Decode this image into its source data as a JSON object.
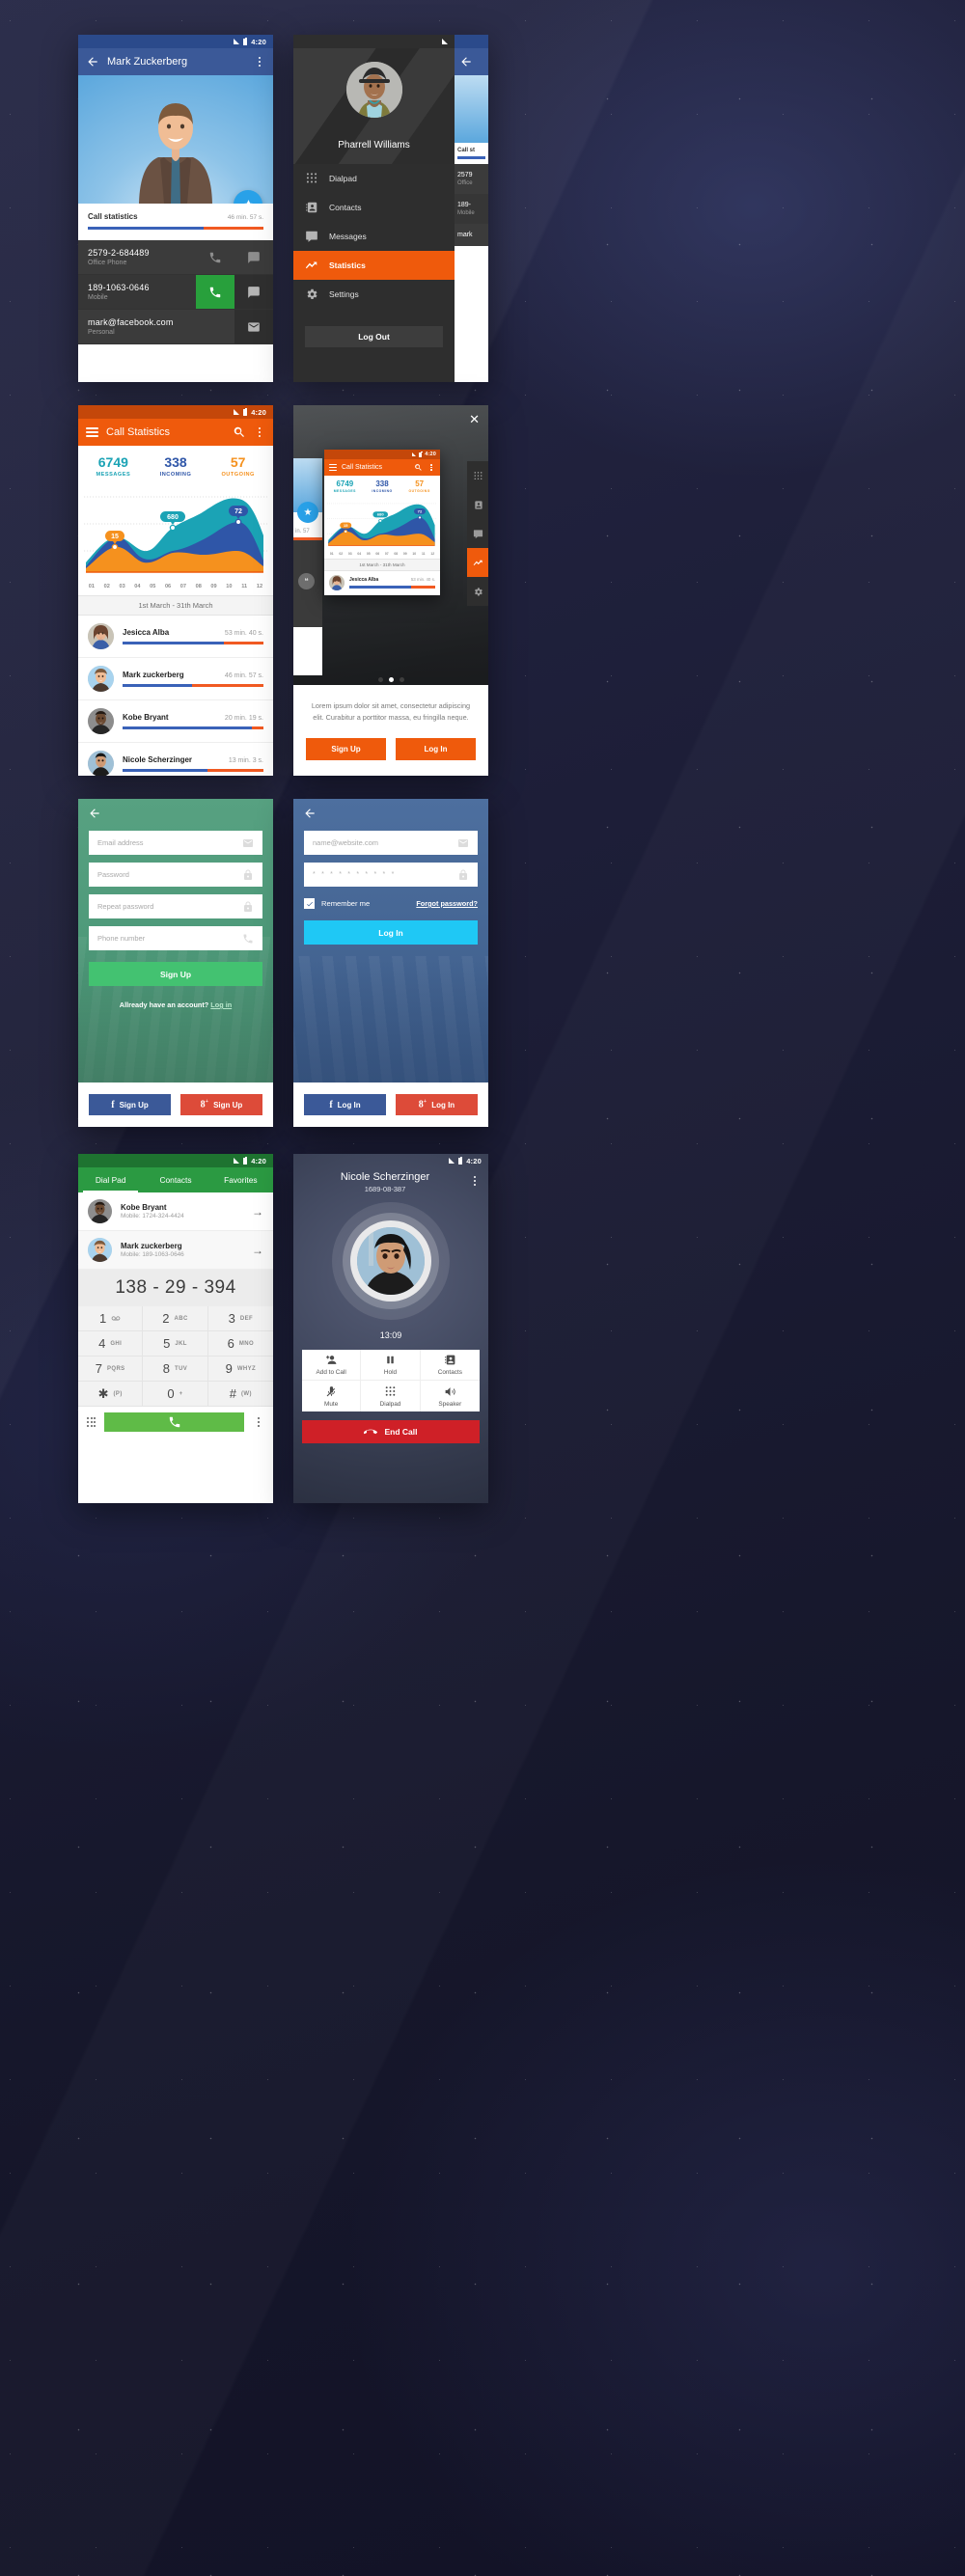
{
  "statusbar": {
    "time": "4:20",
    "signal_icon": "signal-icon",
    "battery_icon": "battery-icon"
  },
  "screen_contact": {
    "title": "Mark Zuckerberg",
    "back_icon": "back-arrow-icon",
    "overflow_icon": "overflow-menu-icon",
    "favorite_icon": "star-icon",
    "stats_label": "Call statistics",
    "stats_value": "46 min. 57 s.",
    "rows": [
      {
        "value": "2579-2-684489",
        "label": "Office Phone",
        "call_icon": "phone-icon",
        "message_icon": "message-icon"
      },
      {
        "value": "189-1063-0646",
        "label": "Mobile",
        "call_icon": "phone-icon",
        "message_icon": "message-icon"
      },
      {
        "value": "mark@facebook.com",
        "label": "Personal",
        "call_icon": "mail-icon",
        "message_icon": "mail-icon"
      }
    ]
  },
  "screen_drawer": {
    "user_name": "Pharrell Williams",
    "avatar_name": "drawer-avatar",
    "items": [
      {
        "label": "Dialpad",
        "icon": "dialpad-icon"
      },
      {
        "label": "Contacts",
        "icon": "contacts-icon"
      },
      {
        "label": "Messages",
        "icon": "messages-icon"
      },
      {
        "label": "Statistics",
        "icon": "statistics-icon"
      },
      {
        "label": "Settings",
        "icon": "settings-icon"
      }
    ],
    "active_index": 3,
    "logout_label": "Log Out",
    "peek_stats_label": "Call st",
    "peek_row1": "2579",
    "peek_row1_sub": "Office",
    "peek_row2": "189-",
    "peek_row2_sub": "Mobile",
    "peek_row3": "mark",
    "accent": "#ef5a0c"
  },
  "screen_statistics": {
    "title": "Call Statistics",
    "menu_icon": "hamburger-icon",
    "search_icon": "search-icon",
    "overflow_icon": "overflow-menu-icon",
    "kpis": [
      {
        "number": "6749",
        "label": "MESSAGES",
        "color": "#1ba3b5"
      },
      {
        "number": "338",
        "label": "INCOMING",
        "color": "#2f56a8"
      },
      {
        "number": "57",
        "label": "OUTGOING",
        "color": "#f5911e"
      }
    ],
    "date_range": "1st March - 31th March",
    "contacts": [
      {
        "name": "Jesicca Alba",
        "duration": "53 min. 40 s.",
        "blue_pct": 72,
        "avatar": "avatar-jessica-alba"
      },
      {
        "name": "Mark zuckerberg",
        "duration": "46 min. 57 s.",
        "blue_pct": 49,
        "avatar": "avatar-mark-zuckerberg"
      },
      {
        "name": "Kobe Bryant",
        "duration": "20 min. 19 s.",
        "blue_pct": 92,
        "avatar": "avatar-kobe-bryant"
      },
      {
        "name": "Nicole Scherzinger",
        "duration": "13 min. 3 s.",
        "blue_pct": 60,
        "avatar": "avatar-nicole-scherzinger"
      }
    ]
  },
  "chart_data": {
    "type": "area",
    "title": "Call Statistics",
    "categories": [
      "01",
      "02",
      "03",
      "04",
      "05",
      "06",
      "07",
      "08",
      "09",
      "10",
      "11",
      "12"
    ],
    "xlabel": "",
    "ylabel": "",
    "ylim": [
      0,
      100
    ],
    "grid": true,
    "legend": "none",
    "series": [
      {
        "name": "MESSAGES",
        "color": "#1ba3b5",
        "values": [
          14,
          26,
          34,
          30,
          22,
          33,
          52,
          60,
          70,
          78,
          74,
          58
        ]
      },
      {
        "name": "INCOMING",
        "color": "#2f56a8",
        "values": [
          10,
          28,
          36,
          24,
          16,
          20,
          26,
          30,
          38,
          52,
          62,
          20
        ]
      },
      {
        "name": "OUTGOING",
        "color": "#f5911e",
        "values": [
          6,
          20,
          28,
          22,
          15,
          22,
          24,
          22,
          20,
          24,
          26,
          12
        ]
      }
    ],
    "annotations": [
      {
        "label": "15",
        "series": "OUTGOING",
        "x": "03",
        "color": "#f5911e"
      },
      {
        "label": "680",
        "series": "MESSAGES",
        "x": "07",
        "color": "#1ba3b5"
      },
      {
        "label": "72",
        "series": "INCOMING",
        "x": "11",
        "color": "#2f56a8"
      }
    ]
  },
  "screen_onboarding": {
    "close_icon": "close-icon",
    "body_text": "Lorem ipsum dolor sit amet, consectetur adipiscing elit. Curabitur a porttitor massa, eu fringilla neque.",
    "signup_label": "Sign Up",
    "login_label": "Log In",
    "pager_dots": 3,
    "pager_active": 1,
    "preview_title": "Call Statistics",
    "preview_date_range": "1st March - 31th March",
    "preview_contact": "Jesicca Alba",
    "preview_duration": "53 min. 40 s.",
    "side_icons": [
      "dialpad-icon",
      "contacts-icon",
      "messages-icon",
      "statistics-icon",
      "settings-icon"
    ],
    "side_active": 3,
    "peek_duration": "in. 57"
  },
  "screen_signup": {
    "back_icon": "back-arrow-icon",
    "fields": [
      {
        "placeholder": "Email address",
        "icon": "mail-icon"
      },
      {
        "placeholder": "Password",
        "icon": "lock-icon"
      },
      {
        "placeholder": "Repeat password",
        "icon": "lock-icon"
      },
      {
        "placeholder": "Phone number",
        "icon": "phone-icon"
      }
    ],
    "submit_label": "Sign Up",
    "footer_text": "Allready have an account?",
    "footer_link": "Log in",
    "facebook_label": "Sign Up",
    "google_label": "Sign Up",
    "accent": "#43c271"
  },
  "screen_login": {
    "back_icon": "back-arrow-icon",
    "fields": [
      {
        "placeholder": "name@website.com",
        "icon": "mail-icon"
      },
      {
        "placeholder": "* * * * * * * * * *",
        "icon": "lock-icon"
      }
    ],
    "remember_label": "Remember me",
    "remember_checked": true,
    "forgot_label": "Forgot password?",
    "submit_label": "Log In",
    "facebook_label": "Log In",
    "google_label": "Log In",
    "accent": "#1fc8f5"
  },
  "screen_dialpad": {
    "tabs": [
      "Dial Pad",
      "Contacts",
      "Favorites"
    ],
    "active_tab": 0,
    "contacts": [
      {
        "name": "Kobe Bryant",
        "sub": "Mobile: 1724-324-4424",
        "avatar": "avatar-kobe-bryant",
        "arrow_icon": "arrow-right-icon"
      },
      {
        "name": "Mark zuckerberg",
        "sub": "Mobile: 189-1063-0646",
        "avatar": "avatar-mark-zuckerberg",
        "arrow_icon": "arrow-right-icon"
      }
    ],
    "display_number": "138 - 29 - 394",
    "keys": [
      {
        "digit": "1",
        "letters": "voicemail-icon"
      },
      {
        "digit": "2",
        "letters": "ABC"
      },
      {
        "digit": "3",
        "letters": "DEF"
      },
      {
        "digit": "4",
        "letters": "GHI"
      },
      {
        "digit": "5",
        "letters": "JKL"
      },
      {
        "digit": "6",
        "letters": "MNO"
      },
      {
        "digit": "7",
        "letters": "PQRS"
      },
      {
        "digit": "8",
        "letters": "TUV"
      },
      {
        "digit": "9",
        "letters": "WHYZ"
      },
      {
        "digit": "✱",
        "letters": "(P)"
      },
      {
        "digit": "0",
        "letters": "+"
      },
      {
        "digit": "#",
        "letters": "(W)"
      }
    ],
    "left_icon": "dialpad-grid-icon",
    "call_icon": "phone-icon",
    "right_icon": "overflow-menu-icon"
  },
  "screen_incall": {
    "name": "Nicole Scherzinger",
    "number": "1689-08-387",
    "duration": "13:09",
    "overflow_icon": "overflow-menu-icon",
    "avatar": "avatar-nicole-scherzinger",
    "actions": [
      {
        "label": "Add to Call",
        "icon": "add-person-icon"
      },
      {
        "label": "Hold",
        "icon": "pause-icon"
      },
      {
        "label": "Contacts",
        "icon": "contacts-icon"
      },
      {
        "label": "Mute",
        "icon": "mute-icon"
      },
      {
        "label": "Dialpad",
        "icon": "dialpad-icon"
      },
      {
        "label": "Speaker",
        "icon": "speaker-icon"
      }
    ],
    "end_call_label": "End Call",
    "end_call_icon": "hangup-icon",
    "end_call_color": "#cf2027"
  }
}
